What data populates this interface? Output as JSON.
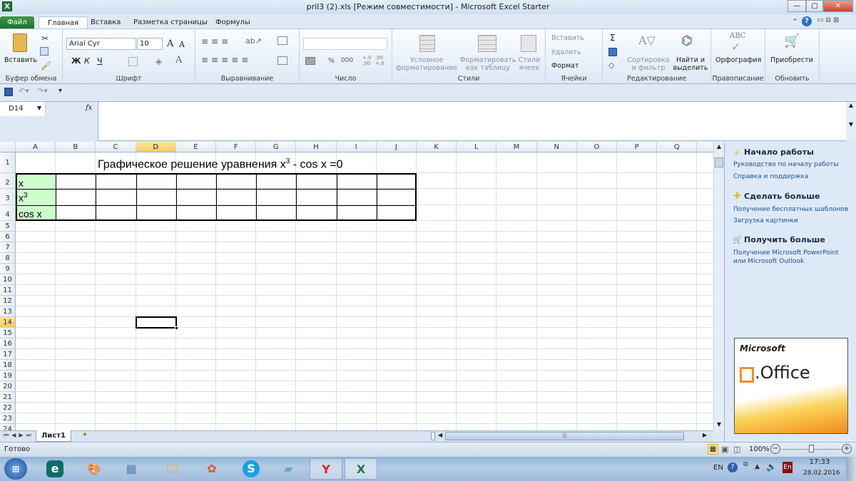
{
  "window": {
    "title": "pril3 (2).xls  [Режим совместимости]  -  Microsoft Excel Starter",
    "app_icon": "X",
    "minimize": "—",
    "maximize": "▢",
    "close": "✕"
  },
  "tabs": [
    {
      "label": "Файл"
    },
    {
      "label": "Главная"
    },
    {
      "label": "Вставка"
    },
    {
      "label": "Разметка страницы"
    },
    {
      "label": "Формулы"
    }
  ],
  "ribbon": {
    "clipboard": {
      "label": "Буфер обмена",
      "paste": "Вставить"
    },
    "font": {
      "label": "Шрифт",
      "font_name": "Arial Cyr",
      "font_size": "10",
      "bold": "Ж",
      "italic": "К",
      "underline": "Ч",
      "grow": "A",
      "shrink": "A",
      "color": "A"
    },
    "alignment": {
      "label": "Выравнивание"
    },
    "number": {
      "label": "Число",
      "format": "",
      "percent": "%",
      "thousands": "000",
      "inc": "+,0 ,00",
      "dec": ",00 +,0"
    },
    "styles": {
      "label": "Стили",
      "conditional": "Условное форматирование",
      "as_table": "Форматировать как таблицу",
      "cell_styles": "Стили ячеек"
    },
    "cells": {
      "label": "Ячейки",
      "insert": "Вставить",
      "delete": "Удалить",
      "format": "Формат"
    },
    "editing": {
      "label": "Редактирование",
      "sum": "Σ",
      "sort": "Сортировка и фильтр",
      "find": "Найти и выделить"
    },
    "proofing": {
      "label": "Правописание",
      "spelling": "Орфография",
      "abc": "ABC"
    },
    "update": {
      "label": "Обновить",
      "buy": "Приобрести"
    }
  },
  "formula_bar": {
    "name_box": "D14",
    "fx": "fx",
    "value": ""
  },
  "grid": {
    "columns": [
      "A",
      "B",
      "C",
      "D",
      "E",
      "F",
      "G",
      "H",
      "I",
      "J",
      "K",
      "L",
      "M",
      "N",
      "O",
      "P",
      "Q"
    ],
    "selected_column": "D",
    "selected_row": "14",
    "rows": 24,
    "title_text": "Графическое решение уравнения x",
    "title_sup": "3",
    "title_rest": " - cos x =0",
    "a2": "x",
    "a3": "x",
    "a3_sup": "3",
    "a4": "cos x",
    "label_fill": "#ccffcc"
  },
  "sheets": {
    "active": "Лист1"
  },
  "task_pane": {
    "sections": [
      {
        "title": "Начало работы",
        "links": [
          "Руководство по началу работы",
          "Справка и поддержка"
        ]
      },
      {
        "title": "Сделать больше",
        "links": [
          "Получение бесплатных шаблонов",
          "Загрузка картинки"
        ]
      },
      {
        "title": "Получить больше",
        "links": [
          "Получение Microsoft PowerPoint или Microsoft Outlook"
        ]
      }
    ],
    "ad": {
      "brand": "Microsoft",
      "product": ".Office"
    }
  },
  "status": {
    "text": "Готово",
    "zoom": "100%",
    "zoom_level": 100
  },
  "taskbar": {
    "lang": "EN",
    "lang2": "En",
    "time": "17:33",
    "date": "28.02.2016"
  }
}
